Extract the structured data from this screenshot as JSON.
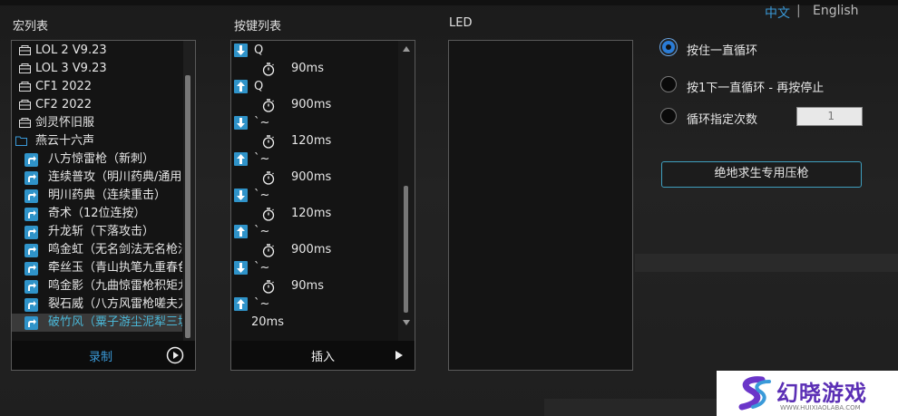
{
  "lang": {
    "zh": "中文",
    "sep": "|",
    "en": "English"
  },
  "macro_list": {
    "title": "宏列表",
    "items": [
      {
        "type": "folder",
        "label": "LOL 2  V9.23"
      },
      {
        "type": "folder",
        "label": "LOL 3  V9.23"
      },
      {
        "type": "folder",
        "label": "CF1 2022"
      },
      {
        "type": "folder",
        "label": "CF2  2022"
      },
      {
        "type": "folder",
        "label": "剑灵怀旧服"
      },
      {
        "type": "folder-open",
        "label": "燕云十六声"
      },
      {
        "type": "macro",
        "label": "八方惊雷枪（新刺）"
      },
      {
        "type": "macro",
        "label": "连续普攻（明川药典/通用）"
      },
      {
        "type": "macro",
        "label": "明川药典（连续重击）"
      },
      {
        "type": "macro",
        "label": "奇术（12位连按）"
      },
      {
        "type": "macro",
        "label": "升龙斩（下落攻击）"
      },
      {
        "type": "macro",
        "label": "鸣金虹（无名剑法无名枪法）"
      },
      {
        "type": "macro",
        "label": "牵丝玉（青山执笔九重春色）"
      },
      {
        "type": "macro",
        "label": "鸣金影（九曲惊雷枪积矩九剑）"
      },
      {
        "type": "macro",
        "label": "裂石威（八方风雷枪嗟夫刀法）"
      },
      {
        "type": "macro",
        "label": "破竹风（粟子游尘泥犁三垢）",
        "selected": true
      }
    ],
    "record_label": "录制"
  },
  "key_list": {
    "title": "按键列表",
    "items": [
      {
        "kind": "down",
        "label": "Q"
      },
      {
        "kind": "delay",
        "label": "90ms"
      },
      {
        "kind": "up",
        "label": "Q"
      },
      {
        "kind": "delay",
        "label": "900ms"
      },
      {
        "kind": "down",
        "label": "`~"
      },
      {
        "kind": "delay",
        "label": "120ms"
      },
      {
        "kind": "up",
        "label": "`~"
      },
      {
        "kind": "delay",
        "label": "900ms"
      },
      {
        "kind": "down",
        "label": "`~"
      },
      {
        "kind": "delay",
        "label": "120ms"
      },
      {
        "kind": "up",
        "label": "`~"
      },
      {
        "kind": "delay",
        "label": "900ms"
      },
      {
        "kind": "down",
        "label": "`~"
      },
      {
        "kind": "delay",
        "label": "90ms"
      },
      {
        "kind": "up",
        "label": "`~"
      },
      {
        "kind": "plain",
        "label": "20ms"
      }
    ],
    "insert_label": "插入"
  },
  "led": {
    "title": "LED"
  },
  "loop_options": [
    {
      "label": "按住一直循环",
      "selected": true
    },
    {
      "label": "按1下一直循环 - 再按停止",
      "selected": false
    },
    {
      "label": "循环指定次数",
      "selected": false
    }
  ],
  "loop_count": "1",
  "pubg_button": "绝地求生专用压枪",
  "watermark": {
    "text": "幻晓游戏",
    "url": "WWW.HUIXIAOLABA.COM"
  },
  "colors": {
    "accent": "#2f93c9",
    "selected_text": "#4ab6d6",
    "lang_active": "#3a9ad9"
  }
}
